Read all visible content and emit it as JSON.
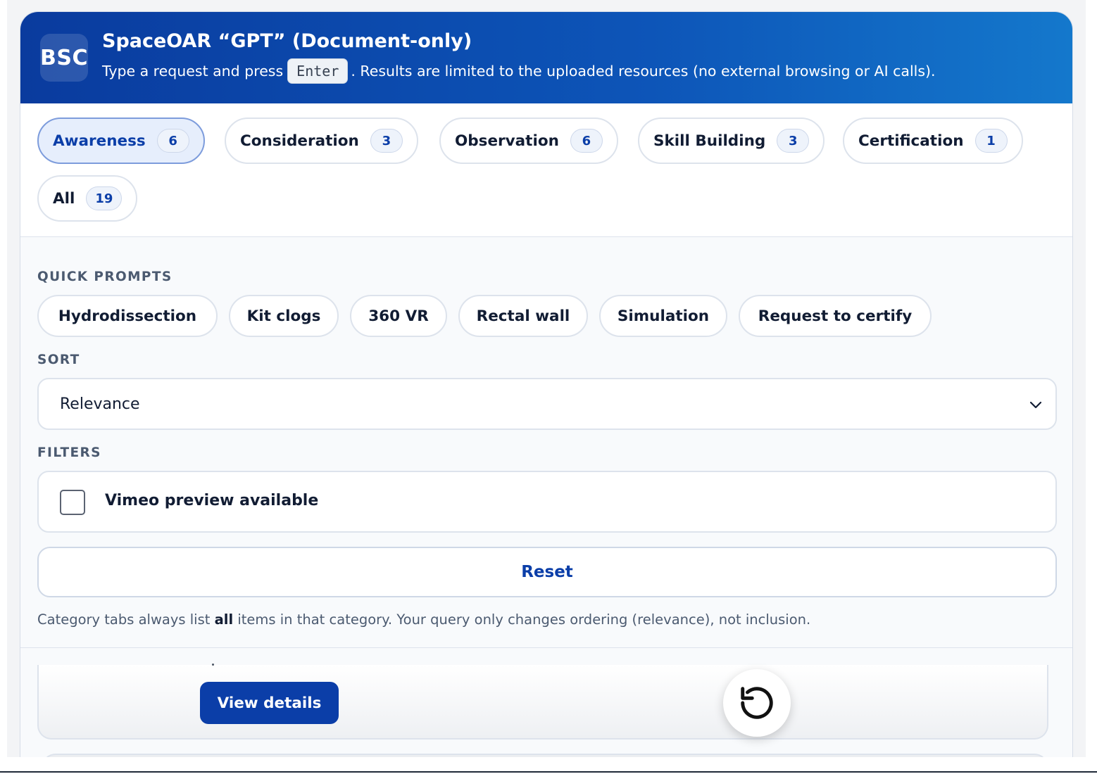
{
  "header": {
    "logo_text": "BSC",
    "title": "SpaceOAR “GPT” (Document-only)",
    "subtitle_before": "Type a request and press",
    "subtitle_key": "Enter",
    "subtitle_after": ". Results are limited to the uploaded resources (no external browsing or AI calls)."
  },
  "tabs": [
    {
      "label": "Awareness",
      "count": "6",
      "active": true
    },
    {
      "label": "Consideration",
      "count": "3",
      "active": false
    },
    {
      "label": "Observation",
      "count": "6",
      "active": false
    },
    {
      "label": "Skill Building",
      "count": "3",
      "active": false
    },
    {
      "label": "Certification",
      "count": "1",
      "active": false
    },
    {
      "label": "All",
      "count": "19",
      "active": false
    }
  ],
  "quick_prompts": {
    "label": "QUICK PROMPTS",
    "items": [
      "Hydrodissection",
      "Kit clogs",
      "360 VR",
      "Rectal wall",
      "Simulation",
      "Request to certify"
    ]
  },
  "sort": {
    "label": "SORT",
    "selected": "Relevance"
  },
  "filters": {
    "label": "FILTERS",
    "vimeo_label": "Vimeo preview available",
    "vimeo_checked": false
  },
  "reset_label": "Reset",
  "note": {
    "before": "Category tabs always list ",
    "bold": "all",
    "after": " items in that category. Your query only changes ordering (relevance), not inclusion."
  },
  "card": {
    "view_details_label": "View details"
  },
  "icons": {
    "sort_chevron": "chevron-down-icon",
    "fab": "rotate-ccw-icon"
  },
  "colors": {
    "accent": "#0b3ea8",
    "header_start": "#0a3b9e",
    "header_end": "#1478cc"
  }
}
